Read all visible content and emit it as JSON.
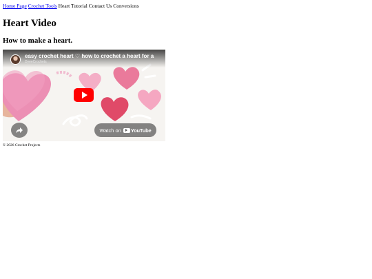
{
  "nav": {
    "links": [
      "Home Page",
      "Crochet Tools"
    ],
    "plain": [
      "Heart Tutorial",
      "Contact Us",
      "Conversions"
    ]
  },
  "page": {
    "title": "Heart Video",
    "subtitle": "How to make a heart."
  },
  "video": {
    "title": "easy crochet heart ♡ how to crochet a heart for a",
    "channel": "DyeeCrochets",
    "watch_label": "Watch on",
    "brand": "YouTube",
    "play_color": "#ff0000"
  },
  "footer": {
    "text": "© 2026 Crochet Projects"
  }
}
